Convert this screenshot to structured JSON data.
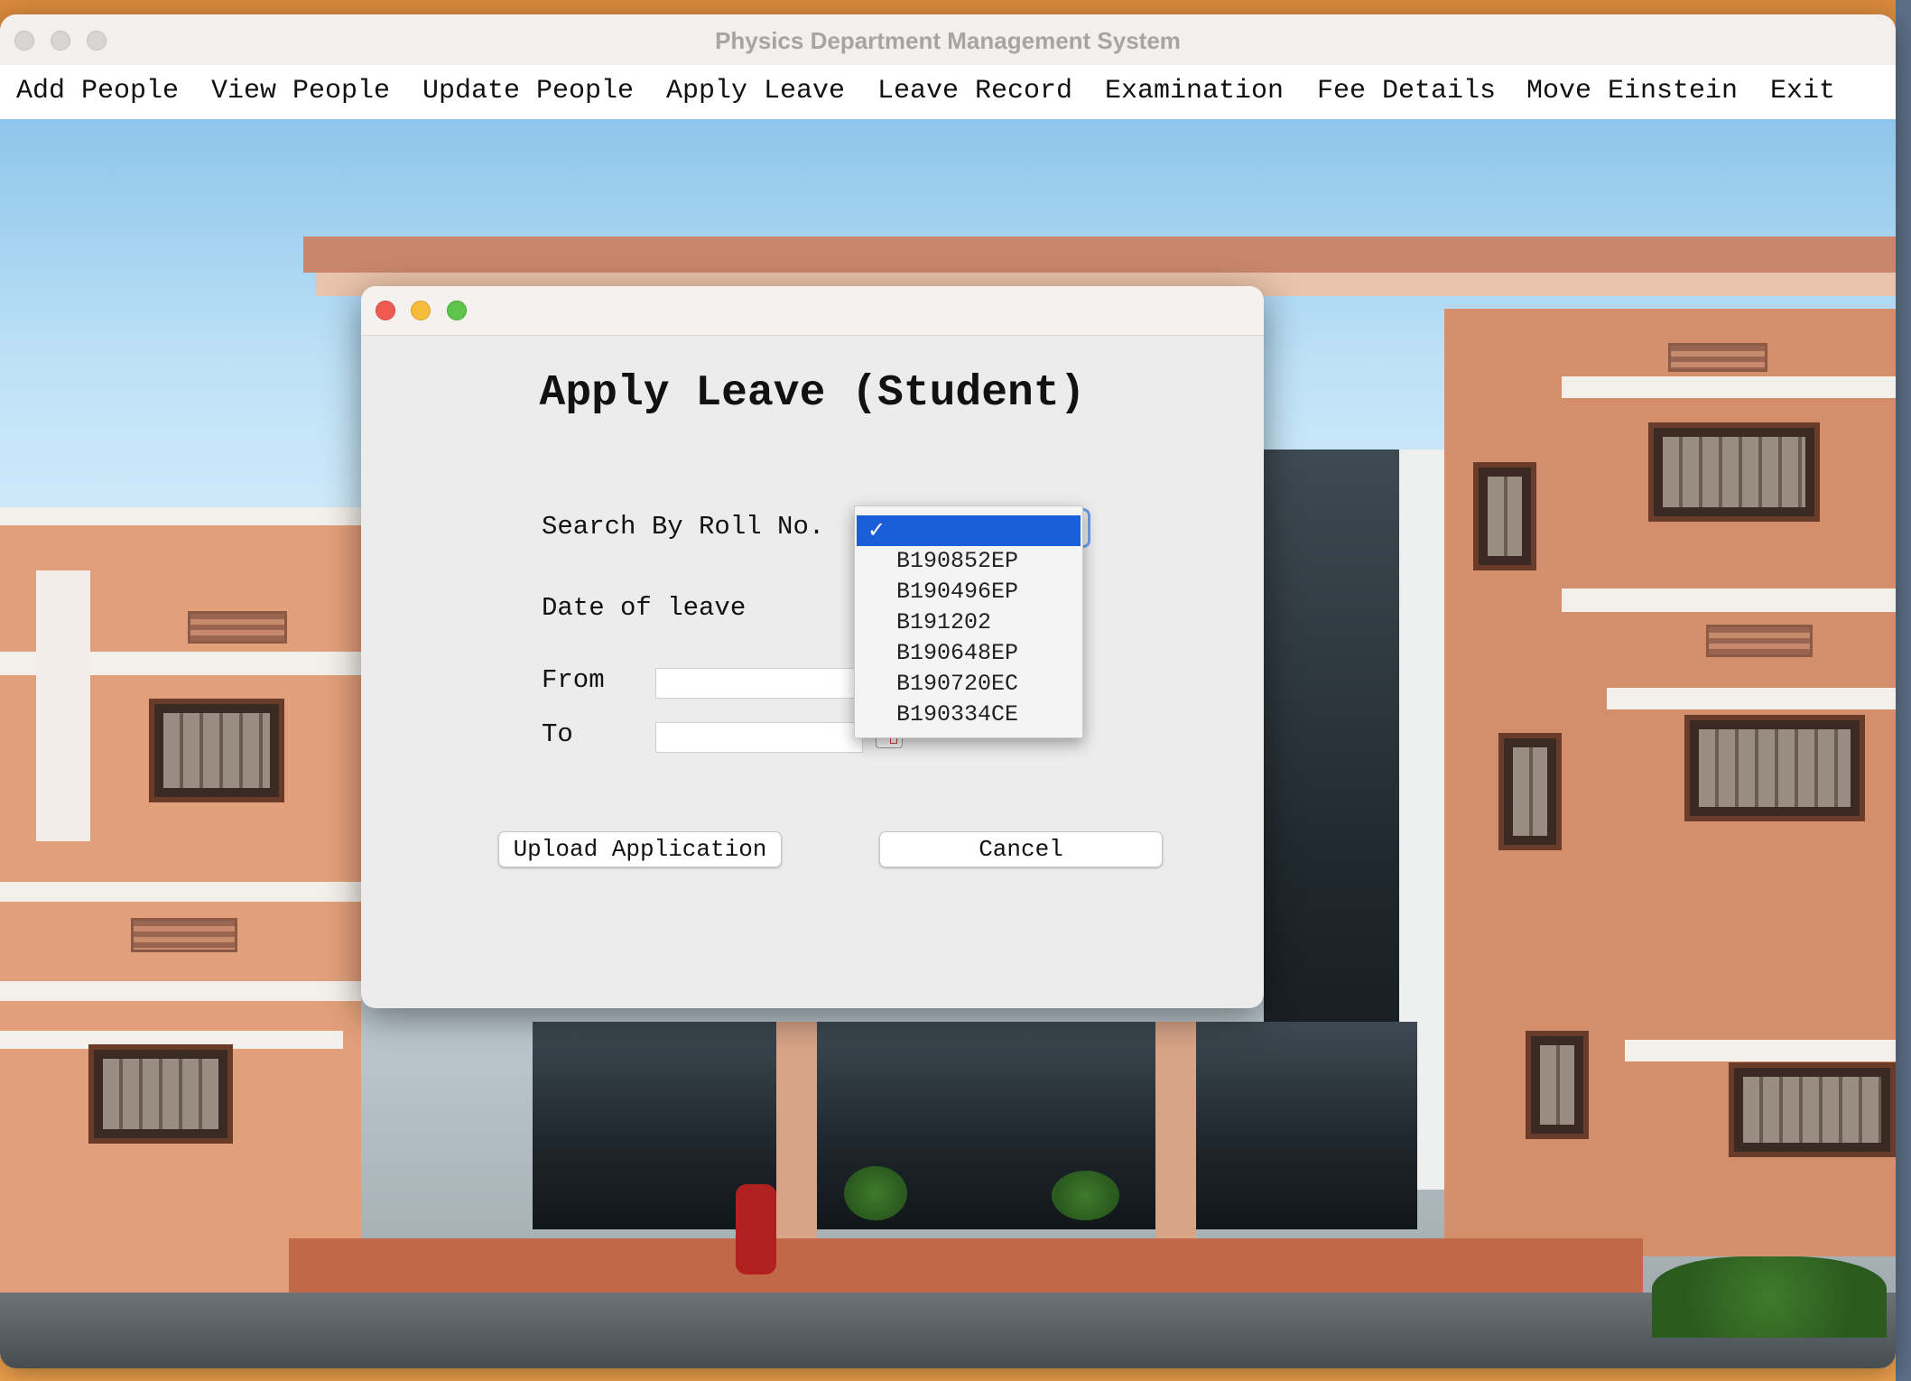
{
  "app": {
    "title": "Physics Department Management System"
  },
  "menu": [
    {
      "label": "Add People"
    },
    {
      "label": "View People"
    },
    {
      "label": "Update People"
    },
    {
      "label": "Apply Leave"
    },
    {
      "label": "Leave Record"
    },
    {
      "label": "Examination"
    },
    {
      "label": "Fee Details"
    },
    {
      "label": "Move Einstein"
    },
    {
      "label": "Exit"
    }
  ],
  "dialog": {
    "heading": "Apply Leave (Student)",
    "search_label": "Search By Roll No.",
    "date_label": "Date of leave",
    "from_label": "From",
    "to_label": "To",
    "from_value": "",
    "to_value": "",
    "upload_button": "Upload Application",
    "cancel_button": "Cancel"
  },
  "roll_dropdown": {
    "selected_value": "",
    "check_mark": "✓",
    "options": [
      "B190852EP",
      "B190496EP",
      "B191202",
      "B190648EP",
      "B190720EC",
      "B190334CE"
    ]
  },
  "colors": {
    "selection": "#1b5fd8",
    "close": "#ee5b53",
    "minimize": "#f5bd3b",
    "zoom": "#5fc44a"
  }
}
